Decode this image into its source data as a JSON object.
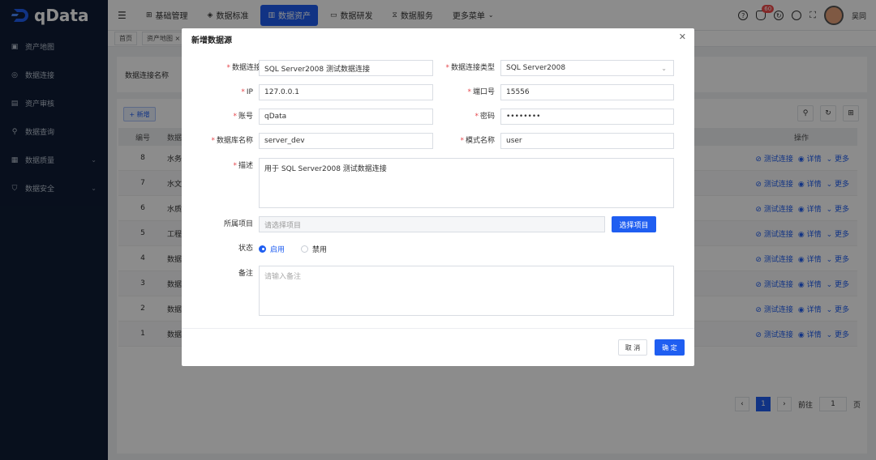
{
  "app": {
    "logo_text": "qData"
  },
  "sidebar": {
    "items": [
      {
        "label": "资产地图",
        "icon": "map-icon"
      },
      {
        "label": "数据连接",
        "icon": "connection-icon"
      },
      {
        "label": "资产审核",
        "icon": "audit-icon"
      },
      {
        "label": "数据查询",
        "icon": "search-icon"
      },
      {
        "label": "数据质量",
        "icon": "quality-icon"
      },
      {
        "label": "数据安全",
        "icon": "shield-icon"
      }
    ]
  },
  "topnav": {
    "items": [
      {
        "label": "基础管理"
      },
      {
        "label": "数据标准"
      },
      {
        "label": "数据资产"
      },
      {
        "label": "数据研发"
      },
      {
        "label": "数据服务"
      },
      {
        "label": "更多菜单"
      }
    ],
    "notif_count": "60",
    "user_name": "吴同"
  },
  "tabs": {
    "home": "首页",
    "current": "资产地图 ×"
  },
  "filter": {
    "label": "数据连接名称"
  },
  "table": {
    "add_label": "+ 新增",
    "header": {
      "no": "编号",
      "name": "数据",
      "ops": "操作"
    },
    "rows": [
      {
        "no": "8",
        "name": "水务"
      },
      {
        "no": "7",
        "name": "水文"
      },
      {
        "no": "6",
        "name": "水质"
      },
      {
        "no": "5",
        "name": "工程"
      },
      {
        "no": "4",
        "name": "数据"
      },
      {
        "no": "3",
        "name": "数据"
      },
      {
        "no": "2",
        "name": "数据"
      },
      {
        "no": "1",
        "name": "数据"
      }
    ],
    "op_test": "测试连接",
    "op_detail": "详情",
    "op_more": "更多"
  },
  "pager": {
    "current": "1",
    "goto_label": "前往",
    "goto_value": "1",
    "page_suffix": "页"
  },
  "dialog": {
    "title": "新增数据源",
    "fields": {
      "conn_name_label": "数据连接名称",
      "conn_name_value": "SQL Server2008 测试数据连接",
      "conn_type_label": "数据连接类型",
      "conn_type_value": "SQL Server2008",
      "ip_label": "IP",
      "ip_value": "127.0.0.1",
      "port_label": "端口号",
      "port_value": "15556",
      "account_label": "账号",
      "account_value": "qData",
      "password_label": "密码",
      "password_value": "••••••••",
      "db_label": "数据库名称",
      "db_value": "server_dev",
      "schema_label": "模式名称",
      "schema_value": "user",
      "desc_label": "描述",
      "desc_value": "用于 SQL Server2008 测试数据连接",
      "project_label": "所属项目",
      "project_placeholder": "请选择项目",
      "project_button": "选择项目",
      "status_label": "状态",
      "status_on": "启用",
      "status_off": "禁用",
      "remark_label": "备注",
      "remark_placeholder": "请输入备注"
    },
    "cancel_label": "取 消",
    "ok_label": "确 定"
  },
  "colors": {
    "primary": "#1f5ef1",
    "sidebar_bg": "#0f1d35",
    "required": "#e5484d"
  }
}
